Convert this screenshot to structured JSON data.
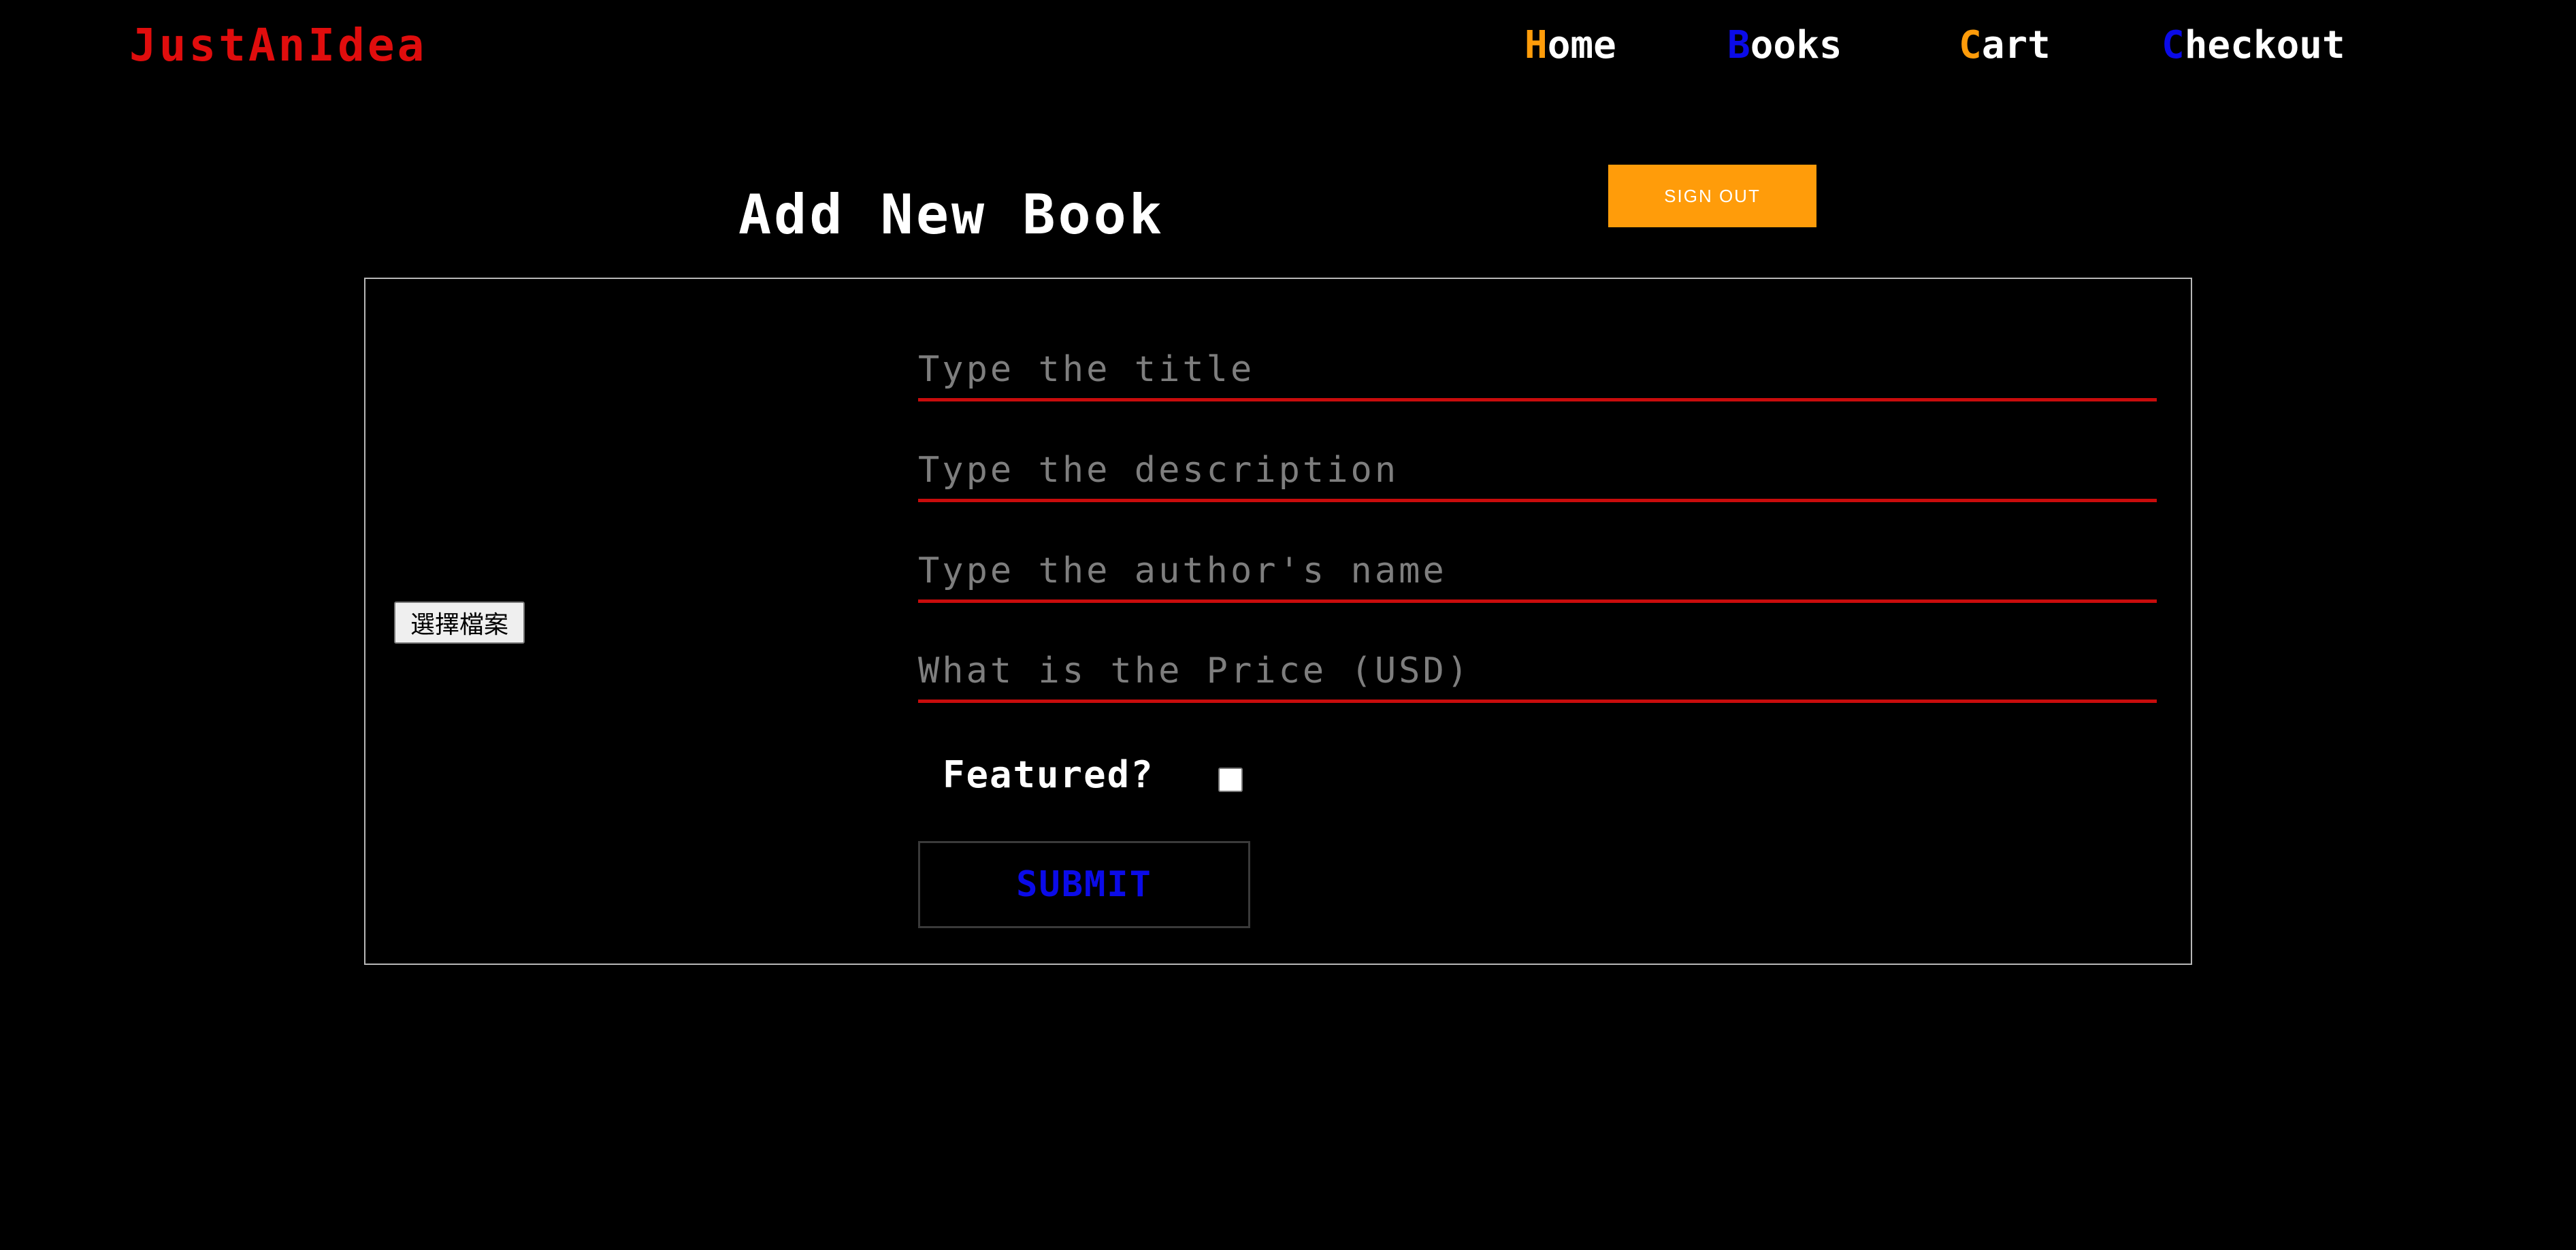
{
  "header": {
    "logo": "JustAnIdea",
    "nav": [
      {
        "first": "H",
        "rest": "ome",
        "accent": "#ff9c0a"
      },
      {
        "first": "B",
        "rest": "ooks",
        "accent": "#0b0be8"
      },
      {
        "first": "C",
        "rest": "art",
        "accent": "#ff9c0a"
      },
      {
        "first": "C",
        "rest": "heckout",
        "accent": "#0b0be8"
      }
    ]
  },
  "page": {
    "title": "Add New Book",
    "signout_label": "SIGN OUT"
  },
  "form": {
    "file_button_label": "選擇檔案",
    "title_placeholder": "Type the title",
    "description_placeholder": "Type the description",
    "author_placeholder": "Type the author's name",
    "price_placeholder": "What is the Price (USD)",
    "featured_label": "Featured?",
    "submit_label": "SUBMIT"
  },
  "colors": {
    "logo": "#e00d0d",
    "orange_accent": "#ff9c0a",
    "blue_accent": "#0b0be8",
    "field_underline": "#c90c0c",
    "background": "#000000"
  }
}
